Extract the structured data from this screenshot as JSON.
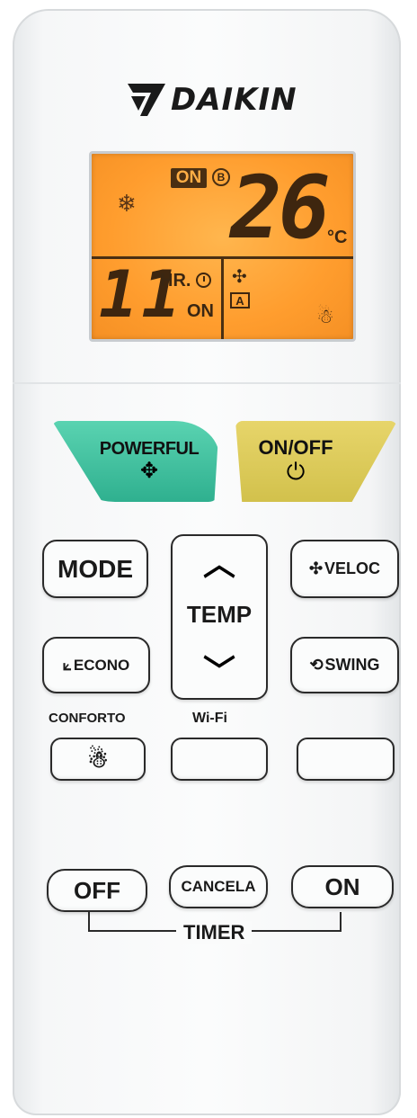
{
  "brand": {
    "name": "DAIKIN"
  },
  "display": {
    "status_badge": "ON",
    "circle_icon": "B",
    "mode_icon": "snowflake-icon",
    "temperature": "26",
    "temperature_unit": "°C",
    "timer_hours": "11",
    "timer_unit": "HR.",
    "timer_state": "ON",
    "fan_mode": "A"
  },
  "buttons": {
    "powerful": "POWERFUL",
    "on_off": "ON/OFF",
    "mode": "MODE",
    "veloc": "VELOC",
    "temp": "TEMP",
    "econo": "ECONO",
    "swing": "SWING",
    "conforto": "CONFORTO",
    "wifi": "Wi-Fi",
    "timer_off": "OFF",
    "timer_cancel": "CANCELA",
    "timer_on": "ON",
    "timer_group": "TIMER"
  },
  "colors": {
    "lcd_backlight": "#ff9d2e",
    "powerful_button": "#3cc09d",
    "onoff_button": "#dccb58"
  }
}
